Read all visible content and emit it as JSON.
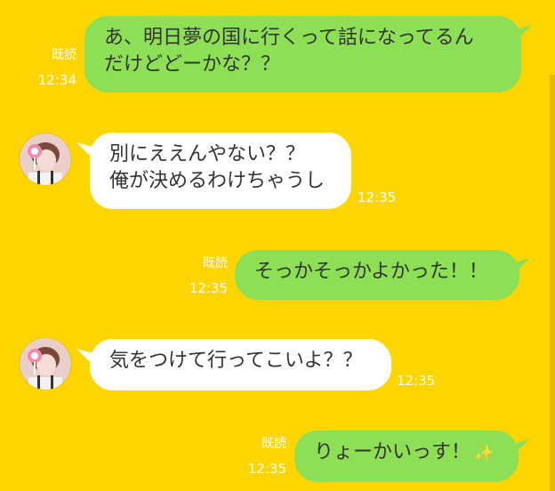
{
  "theme": {
    "background": "#FFD500",
    "outgoing_bubble": "#8DE055",
    "incoming_bubble": "#FFFFFF",
    "meta_text": "#FFFFFF"
  },
  "messages": [
    {
      "direction": "out",
      "line1": "あ、明日夢の国に行くって話になってるん",
      "line2": "だけどどーかな？？",
      "read": "既読",
      "time": "12:34"
    },
    {
      "direction": "in",
      "line1": "別にええんやない？？",
      "line2": "俺が決めるわけちゃうし",
      "time": "12:35",
      "avatar_icon": "avatar-icon"
    },
    {
      "direction": "out",
      "text": "そっかそっかよかった！！",
      "read": "既読",
      "time": "12:35"
    },
    {
      "direction": "in",
      "text": "気をつけて行ってこいよ？？",
      "time": "12:35",
      "avatar_icon": "avatar-icon"
    },
    {
      "direction": "out",
      "text": "りょーかいっす！",
      "sparkle": "✨",
      "read": "既読",
      "time": "12:35"
    }
  ]
}
